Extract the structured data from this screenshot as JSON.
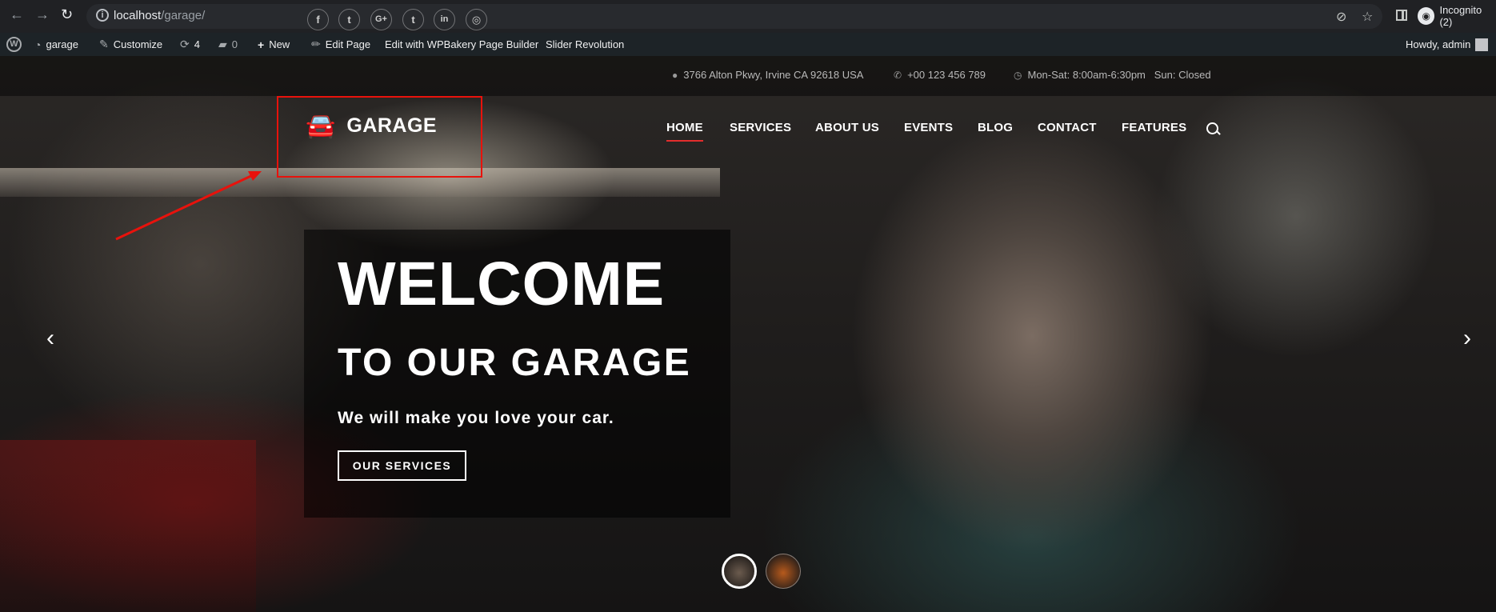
{
  "browser": {
    "url_host": "localhost",
    "url_path": "/garage/",
    "profile_label": "Incognito (2)"
  },
  "adminbar": {
    "site_name": "garage",
    "customize": "Customize",
    "updates_count": "4",
    "comments_count": "0",
    "new": "New",
    "edit_page": "Edit Page",
    "wpbakery": "Edit with WPBakery Page Builder",
    "slider": "Slider Revolution",
    "howdy": "Howdy, admin"
  },
  "topbar": {
    "social": [
      "f",
      "t",
      "G+",
      "t",
      "in",
      "◎"
    ],
    "address": "3766 Alton Pkwy, Irvine CA 92618 USA",
    "phone": "+00 123 456 789",
    "hours": "Mon-Sat: 8:00am-6:30pm   Sun: Closed"
  },
  "logo": {
    "text": "GARAGE"
  },
  "menu": [
    "HOME",
    "SERVICES",
    "ABOUT US",
    "EVENTS",
    "BLOG",
    "CONTACT",
    "FEATURES"
  ],
  "slide": {
    "title": "WELCOME",
    "subtitle": "TO OUR GARAGE",
    "tagline": "We will make you love your car.",
    "button": "OUR SERVICES"
  },
  "colors": {
    "accent": "#e32d2d",
    "annotation": "#e8120c"
  }
}
